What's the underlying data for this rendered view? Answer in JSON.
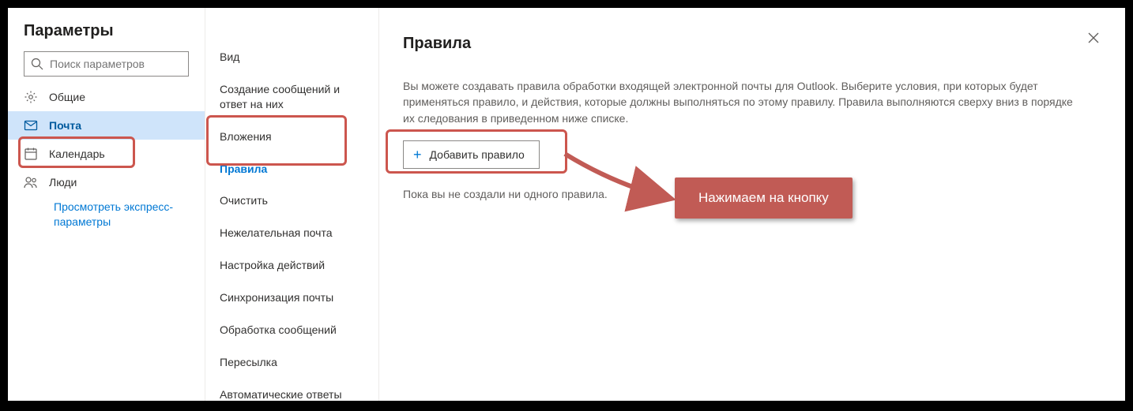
{
  "sidebar": {
    "title": "Параметры",
    "search_placeholder": "Поиск параметров",
    "categories": [
      {
        "key": "general",
        "label": "Общие",
        "icon": "gear-icon"
      },
      {
        "key": "mail",
        "label": "Почта",
        "icon": "mail-icon"
      },
      {
        "key": "calendar",
        "label": "Календарь",
        "icon": "calendar-icon"
      },
      {
        "key": "people",
        "label": "Люди",
        "icon": "people-icon"
      }
    ],
    "selected_category": "mail",
    "quick_link_label": "Просмотреть экспресс-параметры"
  },
  "subnav": {
    "items": [
      "Вид",
      "Создание сообщений и ответ на них",
      "Вложения",
      "Правила",
      "Очистить",
      "Нежелательная почта",
      "Настройка действий",
      "Синхронизация почты",
      "Обработка сообщений",
      "Пересылка",
      "Автоматические ответы"
    ],
    "selected_index": 3
  },
  "main": {
    "heading": "Правила",
    "description": "Вы можете создавать правила обработки входящей электронной почты для Outlook. Выберите условия, при которых будет применяться правило, и действия, которые должны выполняться по этому правилу. Правила выполняются сверху вниз в порядке их следования в приведенном ниже списке.",
    "add_rule_label": "Добавить правило",
    "empty_state": "Пока вы не создали ни одного правила."
  },
  "annotation": {
    "callout_text": "Нажимаем на кнопку",
    "highlight_color": "#cc564e"
  }
}
